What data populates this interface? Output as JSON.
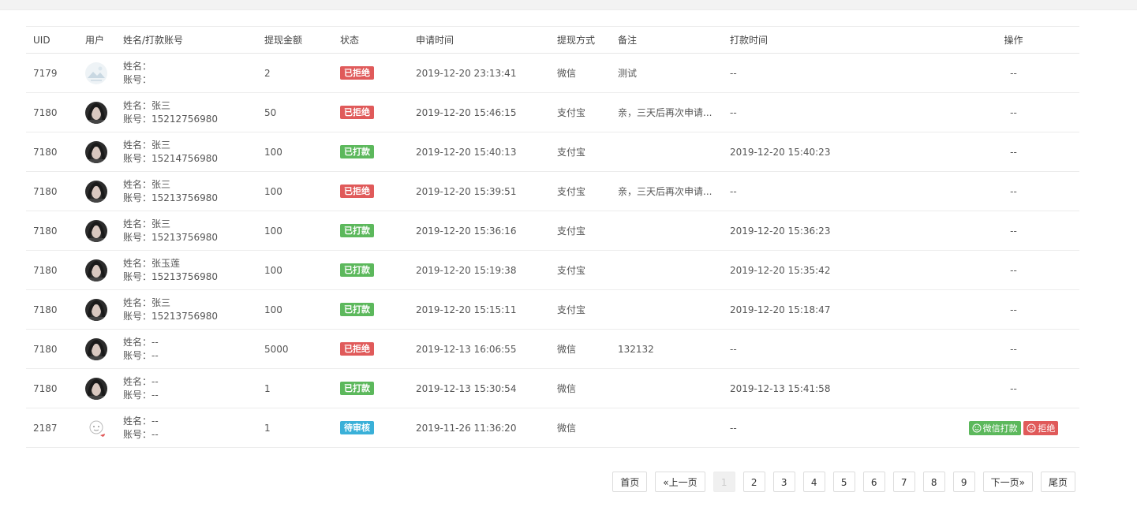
{
  "colors": {
    "rejected": "#e05a5a",
    "paid": "#5cb85c",
    "pending": "#3ab0d8",
    "wechat_pay_button": "#5cb85c",
    "reject_button": "#e05a5a"
  },
  "table": {
    "headers": {
      "uid": "UID",
      "user": "用户",
      "name_account": "姓名/打款账号",
      "amount": "提现金额",
      "status": "状态",
      "apply_time": "申请时间",
      "method": "提现方式",
      "note": "备注",
      "pay_time": "打款时间",
      "action": "操作"
    },
    "rows": [
      {
        "uid": "7179",
        "name": "姓名：",
        "account": "账号：",
        "amount": "2",
        "status": "已拒绝",
        "status_type": "rejected",
        "apply_time": "2019-12-20 23:13:41",
        "method": "微信",
        "note": "测试",
        "pay_time": "--",
        "action": "--",
        "avatar": "landscape-avatar"
      },
      {
        "uid": "7180",
        "name": "姓名：张三",
        "account": "账号：15212756980",
        "amount": "50",
        "status": "已拒绝",
        "status_type": "rejected",
        "apply_time": "2019-12-20 15:46:15",
        "method": "支付宝",
        "note": "亲，三天后再次申请...",
        "pay_time": "--",
        "action": "--",
        "avatar": "portrait-avatar"
      },
      {
        "uid": "7180",
        "name": "姓名：张三",
        "account": "账号：15214756980",
        "amount": "100",
        "status": "已打款",
        "status_type": "paid",
        "apply_time": "2019-12-20 15:40:13",
        "method": "支付宝",
        "note": "",
        "pay_time": "2019-12-20 15:40:23",
        "action": "--",
        "avatar": "portrait-avatar"
      },
      {
        "uid": "7180",
        "name": "姓名：张三",
        "account": "账号：15213756980",
        "amount": "100",
        "status": "已拒绝",
        "status_type": "rejected",
        "apply_time": "2019-12-20 15:39:51",
        "method": "支付宝",
        "note": "亲，三天后再次申请...",
        "pay_time": "--",
        "action": "--",
        "avatar": "portrait-avatar"
      },
      {
        "uid": "7180",
        "name": "姓名：张三",
        "account": "账号：15213756980",
        "amount": "100",
        "status": "已打款",
        "status_type": "paid",
        "apply_time": "2019-12-20 15:36:16",
        "method": "支付宝",
        "note": "",
        "pay_time": "2019-12-20 15:36:23",
        "action": "--",
        "avatar": "portrait-avatar"
      },
      {
        "uid": "7180",
        "name": "姓名：张玉莲",
        "account": "账号：15213756980",
        "amount": "100",
        "status": "已打款",
        "status_type": "paid",
        "apply_time": "2019-12-20 15:19:38",
        "method": "支付宝",
        "note": "",
        "pay_time": "2019-12-20 15:35:42",
        "action": "--",
        "avatar": "portrait-avatar"
      },
      {
        "uid": "7180",
        "name": "姓名：张三",
        "account": "账号：15213756980",
        "amount": "100",
        "status": "已打款",
        "status_type": "paid",
        "apply_time": "2019-12-20 15:15:11",
        "method": "支付宝",
        "note": "",
        "pay_time": "2019-12-20 15:18:47",
        "action": "--",
        "avatar": "portrait-avatar"
      },
      {
        "uid": "7180",
        "name": "姓名：--",
        "account": "账号：--",
        "amount": "5000",
        "status": "已拒绝",
        "status_type": "rejected",
        "apply_time": "2019-12-13 16:06:55",
        "method": "微信",
        "note": "132132",
        "pay_time": "--",
        "action": "--",
        "avatar": "portrait-avatar"
      },
      {
        "uid": "7180",
        "name": "姓名：--",
        "account": "账号：--",
        "amount": "1",
        "status": "已打款",
        "status_type": "paid",
        "apply_time": "2019-12-13 15:30:54",
        "method": "微信",
        "note": "",
        "pay_time": "2019-12-13 15:41:58",
        "action": "--",
        "avatar": "portrait-avatar"
      },
      {
        "uid": "2187",
        "name": "姓名：--",
        "account": "账号：--",
        "amount": "1",
        "status": "待审核",
        "status_type": "pending",
        "apply_time": "2019-11-26 11:36:20",
        "method": "微信",
        "note": "",
        "pay_time": "--",
        "action": "buttons",
        "avatar": "cartoon-avatar"
      }
    ]
  },
  "actions": {
    "wechat_pay": "微信打款",
    "wechat_pay_icon": "smile-icon",
    "reject": "拒绝",
    "reject_icon": "frown-icon"
  },
  "pagination": {
    "first": "首页",
    "prev": "«上一页",
    "pages": [
      "1",
      "2",
      "3",
      "4",
      "5",
      "6",
      "7",
      "8",
      "9"
    ],
    "current": "1",
    "next": "下一页»",
    "last": "尾页"
  }
}
